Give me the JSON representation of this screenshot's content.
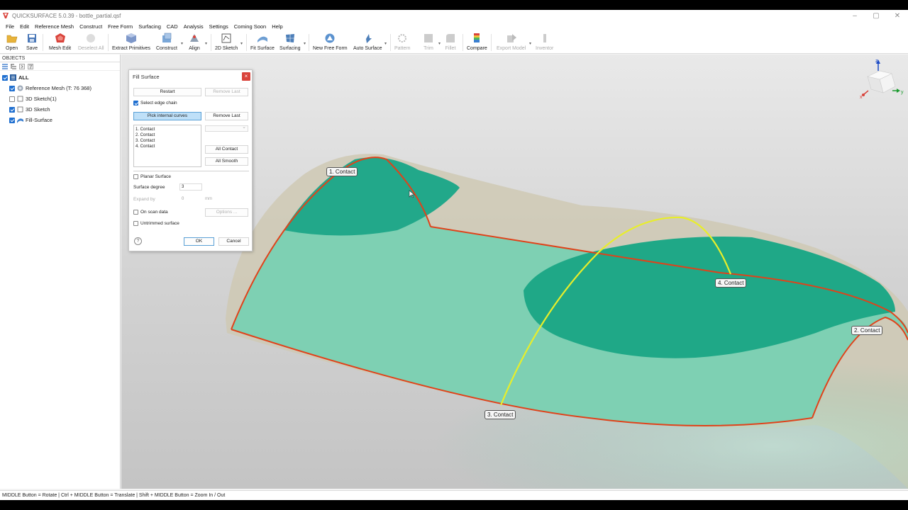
{
  "app": {
    "title": "QUICKSURFACE 5.0.39 - bottle_partial.qsf"
  },
  "menu": [
    "File",
    "Edit",
    "Reference Mesh",
    "Construct",
    "Free Form",
    "Surfacing",
    "CAD",
    "Analysis",
    "Settings",
    "Coming Soon",
    "Help"
  ],
  "toolbar": {
    "items": [
      {
        "label": "Open",
        "icon": "folder-open-icon",
        "enabled": true
      },
      {
        "label": "Save",
        "icon": "save-icon",
        "enabled": true
      },
      {
        "label": "Mesh Edit",
        "icon": "mesh-edit-icon",
        "enabled": true
      },
      {
        "label": "Deselect All",
        "icon": "deselect-icon",
        "enabled": false
      },
      {
        "label": "Extract Primitives",
        "icon": "extract-primitives-icon",
        "enabled": true
      },
      {
        "label": "Construct",
        "icon": "construct-icon",
        "enabled": true
      },
      {
        "label": "Align",
        "icon": "align-icon",
        "enabled": true
      },
      {
        "label": "2D Sketch",
        "icon": "sketch-2d-icon",
        "enabled": true
      },
      {
        "label": "Fit Surface",
        "icon": "fit-surface-icon",
        "enabled": true
      },
      {
        "label": "Surfacing",
        "icon": "surfacing-icon",
        "enabled": true
      },
      {
        "label": "New Free Form",
        "icon": "free-form-icon",
        "enabled": true
      },
      {
        "label": "Auto Surface",
        "icon": "auto-surface-icon",
        "enabled": true
      },
      {
        "label": "Pattern",
        "icon": "pattern-icon",
        "enabled": false
      },
      {
        "label": "Trim",
        "icon": "trim-icon",
        "enabled": false
      },
      {
        "label": "Fillet",
        "icon": "fillet-icon",
        "enabled": false
      },
      {
        "label": "Compare",
        "icon": "compare-icon",
        "enabled": true
      },
      {
        "label": "Export Model",
        "icon": "export-icon",
        "enabled": false
      },
      {
        "label": "Inventor",
        "icon": "inventor-icon",
        "enabled": false
      }
    ]
  },
  "objects_panel": {
    "header": "OBJECTS",
    "tree": [
      {
        "label": "ALL",
        "checked": true,
        "bold": true,
        "icon": "list-icon"
      },
      {
        "label": "Reference Mesh (T: 76 368)",
        "checked": true,
        "bold": false,
        "icon": "mesh-icon"
      },
      {
        "label": "3D Sketch(1)",
        "checked": false,
        "bold": false,
        "icon": "sketch-3d-icon"
      },
      {
        "label": "3D Sketch",
        "checked": true,
        "bold": false,
        "icon": "sketch-3d-icon"
      },
      {
        "label": "Fill-Surface",
        "checked": true,
        "bold": false,
        "icon": "surface-icon"
      }
    ]
  },
  "dialog": {
    "title": "Fill Surface",
    "close": "×",
    "restart": "Restart",
    "remove_last_top": "Remove Last",
    "select_edge_chain": "Select edge chain",
    "pick_internal_curves": "Pick internal curves",
    "remove_last": "Remove Last",
    "list": [
      "1. Contact",
      "2. Contact",
      "3. Contact",
      "4. Contact"
    ],
    "all_contact": "All Contact",
    "all_smooth": "All Smooth",
    "planar_surface": "Planar Surface",
    "surface_degree_label": "Surface degree",
    "surface_degree_value": "3",
    "expand_by_label": "Expand by",
    "expand_by_value": "0",
    "expand_unit": "mm",
    "on_scan_data": "On scan data",
    "options": "Options ...",
    "untrimmed_surface": "Untrimmed surface",
    "help": "?",
    "ok": "OK",
    "cancel": "Cancel"
  },
  "viewport": {
    "contact_tags": [
      "1. Contact",
      "2. Contact",
      "3. Contact",
      "4. Contact"
    ],
    "axes": {
      "z": "z",
      "y": "y",
      "x": "x"
    }
  },
  "status_bar": "MIDDLE Button = Rotate | Ctrl + MIDDLE Button = Translate | Shift + MIDDLE Button = Zoom In / Out",
  "colors": {
    "surface": "#3fb898",
    "surface_light": "#8fd6bf",
    "edge": "#e0421a",
    "curve": "#e8ee2a",
    "accent": "#1f6fd0"
  }
}
